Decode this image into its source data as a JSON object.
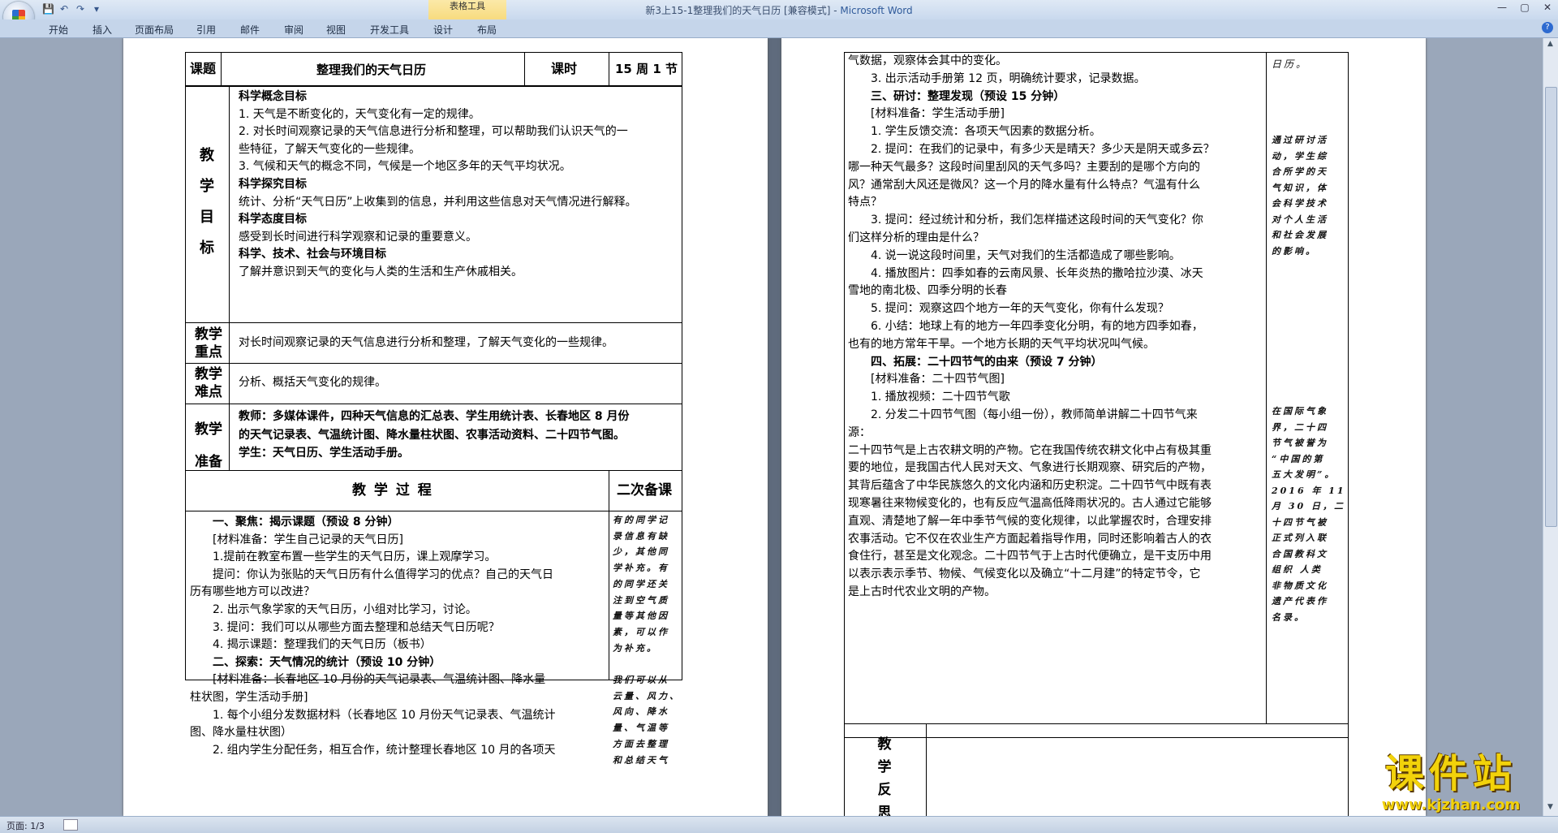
{
  "window": {
    "title": "新3上15-1整理我们的天气日历 [兼容模式] - ",
    "app_name": "Microsoft Word",
    "context_group": "表格工具",
    "controls": [
      "—",
      "▢",
      "✕"
    ]
  },
  "ribbon_tabs": [
    "开始",
    "插入",
    "页面布局",
    "引用",
    "邮件",
    "审阅",
    "视图",
    "开发工具",
    "设计",
    "布局"
  ],
  "status": {
    "page": "页面: 1/3"
  },
  "watermark": {
    "text": "课件站",
    "url": "www.kjzhan.com"
  },
  "page1": {
    "header": {
      "topic_label": "课题",
      "topic": "整理我们的天气日历",
      "period_label": "课时",
      "period": "15 周 1 节"
    },
    "goals_label": "教学目标",
    "goals": [
      {
        "text": "科学概念目标",
        "bold": true
      },
      {
        "text": "1. 天气是不断变化的，天气变化有一定的规律。",
        "bold": false
      },
      {
        "text": "2. 对长时间观察记录的天气信息进行分析和整理，可以帮助我们认识天气的一",
        "bold": false
      },
      {
        "text": "些特征，了解天气变化的一些规律。",
        "bold": false
      },
      {
        "text": "3. 气候和天气的概念不同，气候是一个地区多年的天气平均状况。",
        "bold": false
      },
      {
        "text": "科学探究目标",
        "bold": true
      },
      {
        "text": "统计、分析“天气日历”上收集到的信息，并利用这些信息对天气情况进行解释。",
        "bold": false
      },
      {
        "text": "科学态度目标",
        "bold": true
      },
      {
        "text": "感受到长时间进行科学观察和记录的重要意义。",
        "bold": false
      },
      {
        "text": "科学、技术、社会与环境目标",
        "bold": true
      },
      {
        "text": "了解并意识到天气的变化与人类的生活和生产休戚相关。",
        "bold": false
      }
    ],
    "key_label": [
      "教学",
      "重点"
    ],
    "key": "对长时间观察记录的天气信息进行分析和整理，了解天气变化的一些规律。",
    "difficulty_label": [
      "教学",
      "难点"
    ],
    "difficulty": "分析、概括天气变化的规律。",
    "prep_label": [
      "教学",
      "准备"
    ],
    "prep": [
      "教师：多媒体课件，四种天气信息的汇总表、学生用统计表、长春地区 8 月份",
      "的天气记录表、气温统计图、降水量柱状图、农事活动资料、二十四节气图。",
      "学生：天气日历、学生活动手册。"
    ],
    "process_label": "教 学 过 程",
    "second_prep_label": "二次备课",
    "process": [
      {
        "text": "一、聚焦：揭示课题（预设 8 分钟）",
        "bold": true,
        "indent": 1
      },
      {
        "text": "[材料准备：学生自己记录的天气日历]",
        "bold": false,
        "indent": 1
      },
      {
        "text": "1.提前在教室布置一些学生的天气日历，课上观摩学习。",
        "bold": false,
        "indent": 1
      },
      {
        "text": "提问：你认为张贴的天气日历有什么值得学习的优点？自己的天气日",
        "bold": false,
        "indent": 1
      },
      {
        "text": "历有哪些地方可以改进？",
        "bold": false,
        "indent": 0
      },
      {
        "text": "2. 出示气象学家的天气日历，小组对比学习，讨论。",
        "bold": false,
        "indent": 1
      },
      {
        "text": "3. 提问：我们可以从哪些方面去整理和总结天气日历呢？",
        "bold": false,
        "indent": 1
      },
      {
        "text": "4. 揭示课题：整理我们的天气日历（板书）",
        "bold": false,
        "indent": 1
      },
      {
        "text": "二、探索：天气情况的统计（预设 10 分钟）",
        "bold": true,
        "indent": 1
      },
      {
        "text": "[材料准备：长春地区 10 月份的天气记录表、气温统计图、降水量",
        "bold": false,
        "indent": 1
      },
      {
        "text": "柱状图，学生活动手册]",
        "bold": false,
        "indent": 0
      },
      {
        "text": "1. 每个小组分发数据材料（长春地区 10 月份天气记录表、气温统计",
        "bold": false,
        "indent": 1
      },
      {
        "text": "图、降水量柱状图）",
        "bold": false,
        "indent": 0
      },
      {
        "text": "2. 组内学生分配任务，相互合作，统计整理长春地区 10 月的各项天",
        "bold": false,
        "indent": 1
      }
    ],
    "second_prep_notes": [
      "有的同学记",
      "录信息有缺",
      "少，其他同",
      "学补充。有",
      "的同学还关",
      "注到空气质",
      "量等其他因",
      "素，可以作",
      "为补充。",
      "",
      "我们可以从",
      "云量、风力、",
      "风向、降水",
      "量、气温等",
      "方面去整理",
      "和总结天气"
    ]
  },
  "page2": {
    "lines": [
      {
        "text": "气数据，观察体会其中的变化。",
        "bold": false,
        "indent": 0
      },
      {
        "text": "3. 出示活动手册第 12 页，明确统计要求，记录数据。",
        "bold": false,
        "indent": 1
      },
      {
        "text": "三、研讨：整理发现（预设 15 分钟）",
        "bold": true,
        "indent": 1
      },
      {
        "text": "[材料准备：学生活动手册]",
        "bold": false,
        "indent": 1
      },
      {
        "text": "1. 学生反馈交流：各项天气因素的数据分析。",
        "bold": false,
        "indent": 1
      },
      {
        "text": "2. 提问：在我们的记录中，有多少天是晴天？多少天是阴天或多云？",
        "bold": false,
        "indent": 1
      },
      {
        "text": "哪一种天气最多？这段时间里刮风的天气多吗？主要刮的是哪个方向的",
        "bold": false,
        "indent": 0
      },
      {
        "text": "风？通常刮大风还是微风？这一个月的降水量有什么特点？气温有什么",
        "bold": false,
        "indent": 0
      },
      {
        "text": "特点？",
        "bold": false,
        "indent": 0
      },
      {
        "text": "3. 提问：经过统计和分析，我们怎样描述这段时间的天气变化？你",
        "bold": false,
        "indent": 1
      },
      {
        "text": "们这样分析的理由是什么？",
        "bold": false,
        "indent": 0
      },
      {
        "text": "4. 说一说这段时间里，天气对我们的生活都造成了哪些影响。",
        "bold": false,
        "indent": 1
      },
      {
        "text": "4. 播放图片：四季如春的云南风景、长年炎热的撒哈拉沙漠、冰天",
        "bold": false,
        "indent": 1
      },
      {
        "text": "雪地的南北极、四季分明的长春",
        "bold": false,
        "indent": 0
      },
      {
        "text": "5. 提问：观察这四个地方一年的天气变化，你有什么发现？",
        "bold": false,
        "indent": 1
      },
      {
        "text": "6. 小结：地球上有的地方一年四季变化分明，有的地方四季如春，",
        "bold": false,
        "indent": 1
      },
      {
        "text": "也有的地方常年干旱。一个地方长期的天气平均状况叫气候。",
        "bold": false,
        "indent": 0
      },
      {
        "text": "四、拓展：二十四节气的由来（预设 7 分钟）",
        "bold": true,
        "indent": 1
      },
      {
        "text": "[材料准备：二十四节气图]",
        "bold": false,
        "indent": 1
      },
      {
        "text": "1. 播放视频：二十四节气歌",
        "bold": false,
        "indent": 1
      },
      {
        "text": "2. 分发二十四节气图（每小组一份），教师简单讲解二十四节气来",
        "bold": false,
        "indent": 1
      },
      {
        "text": "源：",
        "bold": false,
        "indent": 0
      },
      {
        "text": "二十四节气是上古农耕文明的产物。它在我国传统农耕文化中占有极其重",
        "bold": false,
        "indent": 0
      },
      {
        "text": "要的地位，是我国古代人民对天文、气象进行长期观察、研究后的产物，",
        "bold": false,
        "indent": 0
      },
      {
        "text": "其背后蕴含了中华民族悠久的文化内涵和历史积淀。二十四节气中既有表",
        "bold": false,
        "indent": 0
      },
      {
        "text": "现寒暑往来物候变化的，也有反应气温高低降雨状况的。古人通过它能够",
        "bold": false,
        "indent": 0
      },
      {
        "text": "直观、清楚地了解一年中季节气候的变化规律，以此掌握农时，合理安排",
        "bold": false,
        "indent": 0
      },
      {
        "text": "农事活动。它不仅在农业生产方面起着指导作用，同时还影响着古人的衣",
        "bold": false,
        "indent": 0
      },
      {
        "text": "食住行，甚至是文化观念。二十四节气于上古时代便确立，是干支历中用",
        "bold": false,
        "indent": 0
      },
      {
        "text": "以表示表示季节、物候、气候变化以及确立“十二月建”的特定节令，它",
        "bold": false,
        "indent": 0
      },
      {
        "text": "是上古时代农业文明的产物。",
        "bold": false,
        "indent": 0
      }
    ],
    "side_top": "日历。",
    "side_note1": [
      "通过研讨活",
      "动，学生综",
      "合所学的天",
      "气知识，体",
      "会科学技术",
      "对个人生活",
      "和社会发展",
      "的影响。"
    ],
    "side_note2": [
      "在国际气象",
      "界，二十四",
      "节气被誉为",
      "“中国的第",
      "五大发明”。",
      "2016 年 11",
      "月 30 日，二",
      "十四节气被",
      "正式列入联",
      "合国教科文",
      "组织 人类",
      "非物质文化",
      "遗产代表作",
      "名录。"
    ],
    "reflection_label": [
      "教",
      "学",
      "反",
      "思"
    ]
  }
}
